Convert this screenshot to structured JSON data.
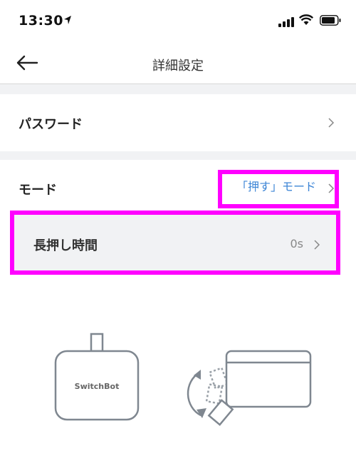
{
  "status_bar": {
    "time": "13:30"
  },
  "nav": {
    "title": "詳細設定"
  },
  "settings": {
    "password_label": "パスワード",
    "mode_label": "モード",
    "mode_value": "「押す」モード",
    "long_press_label": "長押し時間",
    "long_press_value": "0s"
  },
  "illustration": {
    "device_label": "SwitchBot"
  },
  "colors": {
    "accent": "#3e86d6",
    "highlight": "#ff00ff",
    "section_bg": "#f1f2f4"
  },
  "icons": [
    "location-arrow-icon",
    "signal-icon",
    "wifi-icon",
    "battery-icon",
    "back-arrow-icon",
    "chevron-right-icon"
  ]
}
